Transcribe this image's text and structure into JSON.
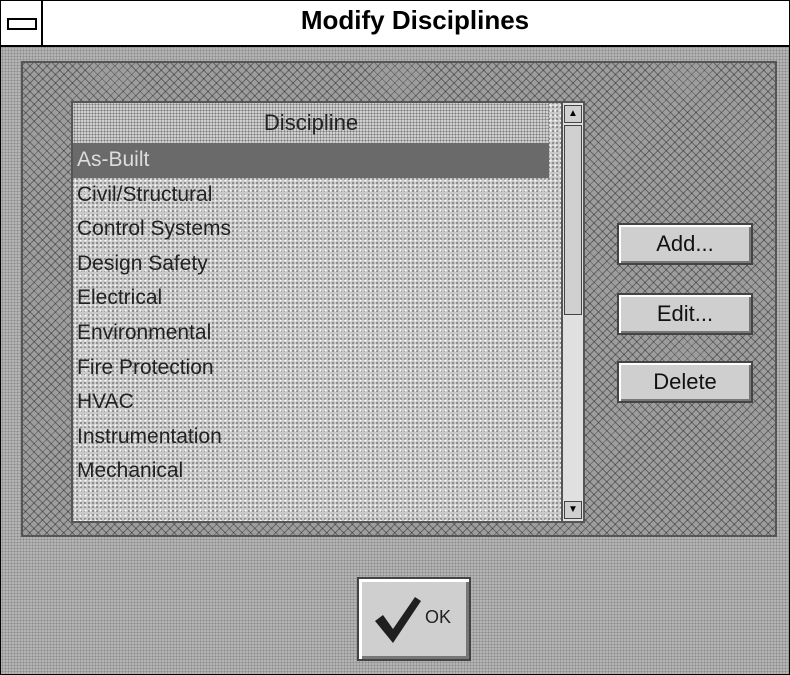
{
  "window": {
    "title": "Modify Disciplines"
  },
  "list": {
    "header": "Discipline",
    "items": [
      "As-Built",
      "Civil/Structural",
      "Control Systems",
      "Design Safety",
      "Electrical",
      "Environmental",
      "Fire Protection",
      "HVAC",
      "Instrumentation",
      "Mechanical"
    ],
    "selected_item": "As-Built"
  },
  "buttons": {
    "add": "Add...",
    "edit": "Edit...",
    "delete": "Delete",
    "ok": "OK"
  },
  "icons": {
    "system_menu": "system-menu-icon",
    "ok": "check-icon",
    "scroll_up": "scroll-up-arrow-icon",
    "scroll_down": "scroll-down-arrow-icon"
  }
}
